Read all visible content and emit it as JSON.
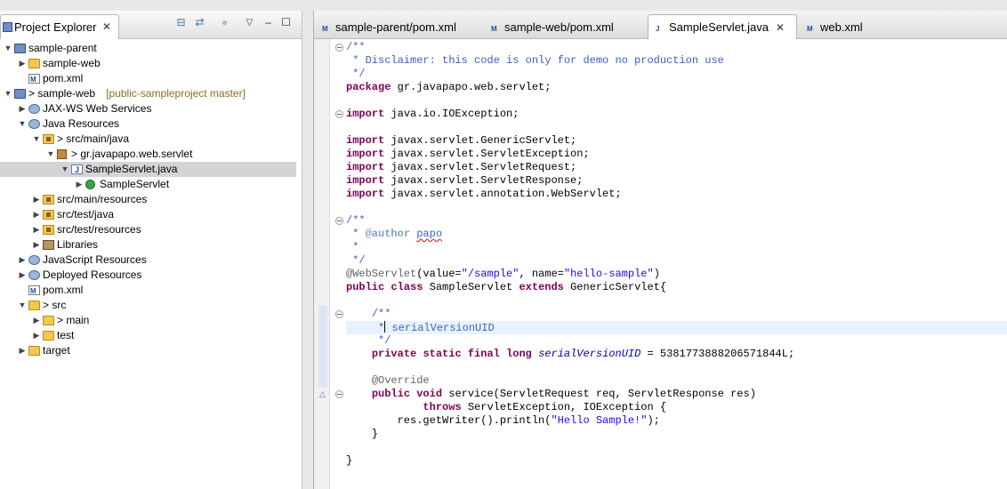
{
  "explorer": {
    "title": "Project Explorer",
    "tree": [
      {
        "label": "sample-parent",
        "decoration": "",
        "icon": "project",
        "depth": 0,
        "state": "expanded"
      },
      {
        "label": "sample-web",
        "decoration": "",
        "icon": "folder",
        "depth": 1,
        "state": "collapsed"
      },
      {
        "label": "pom.xml",
        "decoration": "",
        "icon": "xml",
        "depth": 1,
        "state": "leaf"
      },
      {
        "label": "> sample-web",
        "decoration": "[public-sampleproject master]",
        "icon": "project",
        "depth": 0,
        "state": "expanded"
      },
      {
        "label": "JAX-WS Web Services",
        "decoration": "",
        "icon": "gear",
        "depth": 1,
        "state": "collapsed"
      },
      {
        "label": "Java Resources",
        "decoration": "",
        "icon": "gear",
        "depth": 1,
        "state": "expanded"
      },
      {
        "label": "> src/main/java",
        "decoration": "",
        "icon": "srcfolder",
        "depth": 2,
        "state": "expanded"
      },
      {
        "label": "> gr.javapapo.web.servlet",
        "decoration": "",
        "icon": "package",
        "depth": 3,
        "state": "expanded"
      },
      {
        "label": "SampleServlet.java",
        "decoration": "",
        "icon": "java",
        "depth": 4,
        "state": "expanded",
        "selected": true
      },
      {
        "label": "SampleServlet",
        "decoration": "",
        "icon": "class",
        "depth": 5,
        "state": "collapsed"
      },
      {
        "label": "src/main/resources",
        "decoration": "",
        "icon": "srcfolder",
        "depth": 2,
        "state": "collapsed"
      },
      {
        "label": "src/test/java",
        "decoration": "",
        "icon": "srcfolder",
        "depth": 2,
        "state": "collapsed"
      },
      {
        "label": "src/test/resources",
        "decoration": "",
        "icon": "srcfolder",
        "depth": 2,
        "state": "collapsed"
      },
      {
        "label": "Libraries",
        "decoration": "",
        "icon": "library",
        "depth": 2,
        "state": "collapsed"
      },
      {
        "label": "JavaScript Resources",
        "decoration": "",
        "icon": "gear",
        "depth": 1,
        "state": "collapsed"
      },
      {
        "label": "Deployed Resources",
        "decoration": "",
        "icon": "gear",
        "depth": 1,
        "state": "collapsed"
      },
      {
        "label": "pom.xml",
        "decoration": "",
        "icon": "xml",
        "depth": 1,
        "state": "leaf"
      },
      {
        "label": "> src",
        "decoration": "",
        "icon": "folder",
        "depth": 1,
        "state": "expanded"
      },
      {
        "label": "> main",
        "decoration": "",
        "icon": "folder",
        "depth": 2,
        "state": "collapsed"
      },
      {
        "label": "test",
        "decoration": "",
        "icon": "folder",
        "depth": 2,
        "state": "collapsed"
      },
      {
        "label": "target",
        "decoration": "",
        "icon": "folder",
        "depth": 1,
        "state": "collapsed"
      }
    ]
  },
  "editor": {
    "tabs": [
      {
        "label": "sample-parent/pom.xml",
        "icon": "xml",
        "active": false
      },
      {
        "label": "sample-web/pom.xml",
        "icon": "xml",
        "active": false
      },
      {
        "label": "SampleServlet.java",
        "icon": "java",
        "active": true
      },
      {
        "label": "web.xml",
        "icon": "xml",
        "active": false
      }
    ],
    "lines": [
      [
        [
          "cm",
          "/**"
        ]
      ],
      [
        [
          "cm",
          " * Disclaimer: this code is only for demo no production use"
        ]
      ],
      [
        [
          "cm",
          " */"
        ]
      ],
      [
        [
          "kw",
          "package"
        ],
        [
          "",
          " gr.javapapo.web.servlet;"
        ]
      ],
      [],
      [
        [
          "kw",
          "import"
        ],
        [
          "",
          " java.io.IOException;"
        ]
      ],
      [],
      [
        [
          "kw",
          "import"
        ],
        [
          "",
          " javax.servlet.GenericServlet;"
        ]
      ],
      [
        [
          "kw",
          "import"
        ],
        [
          "",
          " javax.servlet.ServletException;"
        ]
      ],
      [
        [
          "kw",
          "import"
        ],
        [
          "",
          " javax.servlet.ServletRequest;"
        ]
      ],
      [
        [
          "kw",
          "import"
        ],
        [
          "",
          " javax.servlet.ServletResponse;"
        ]
      ],
      [
        [
          "kw",
          "import"
        ],
        [
          "",
          " javax.servlet.annotation.WebServlet;"
        ]
      ],
      [],
      [
        [
          "cm",
          "/**"
        ]
      ],
      [
        [
          "cm",
          " * "
        ],
        [
          "tag",
          "@author"
        ],
        [
          "cm",
          " "
        ],
        [
          "cmsq",
          "papo"
        ]
      ],
      [
        [
          "cm",
          " *"
        ]
      ],
      [
        [
          "cm",
          " */"
        ]
      ],
      [
        [
          "an",
          "@WebServlet"
        ],
        [
          "",
          "(value="
        ],
        [
          "str",
          "\"/sample\""
        ],
        [
          "",
          ", name="
        ],
        [
          "str",
          "\"hello-sample\""
        ],
        [
          "",
          ")"
        ]
      ],
      [
        [
          "kw",
          "public"
        ],
        [
          "",
          " "
        ],
        [
          "kw",
          "class"
        ],
        [
          "",
          " SampleServlet "
        ],
        [
          "kw",
          "extends"
        ],
        [
          "",
          " GenericServlet{"
        ]
      ],
      [],
      [
        [
          "",
          "    "
        ],
        [
          "cm",
          "/**"
        ]
      ],
      [
        [
          "",
          "     "
        ],
        [
          "cm",
          "*"
        ],
        [
          "caret",
          ""
        ],
        [
          "cm",
          " serialVersionUID"
        ]
      ],
      [
        [
          "",
          "     "
        ],
        [
          "cm",
          "*/"
        ]
      ],
      [
        [
          "",
          "    "
        ],
        [
          "kw",
          "private"
        ],
        [
          "",
          " "
        ],
        [
          "kw",
          "static"
        ],
        [
          "",
          " "
        ],
        [
          "kw",
          "final"
        ],
        [
          "",
          " "
        ],
        [
          "kw",
          "long"
        ],
        [
          "",
          " "
        ],
        [
          "fld",
          "serialVersionUID"
        ],
        [
          "",
          " = 5381773888206571844L;"
        ]
      ],
      [],
      [
        [
          "",
          "    "
        ],
        [
          "an",
          "@Override"
        ]
      ],
      [
        [
          "",
          "    "
        ],
        [
          "kw",
          "public"
        ],
        [
          "",
          " "
        ],
        [
          "kw",
          "void"
        ],
        [
          "",
          " service(ServletRequest req, ServletResponse res)"
        ]
      ],
      [
        [
          "",
          "            "
        ],
        [
          "kw",
          "throws"
        ],
        [
          "",
          " ServletException, IOException {"
        ]
      ],
      [
        [
          "",
          "        res.getWriter().println("
        ],
        [
          "str",
          "\"Hello Sample!\""
        ],
        [
          "",
          ");"
        ]
      ],
      [
        [
          "",
          "    }"
        ]
      ],
      [],
      [
        [
          "",
          "}"
        ]
      ]
    ],
    "current_line": 21,
    "fold_lines": [
      0,
      5,
      13,
      20,
      26
    ]
  }
}
